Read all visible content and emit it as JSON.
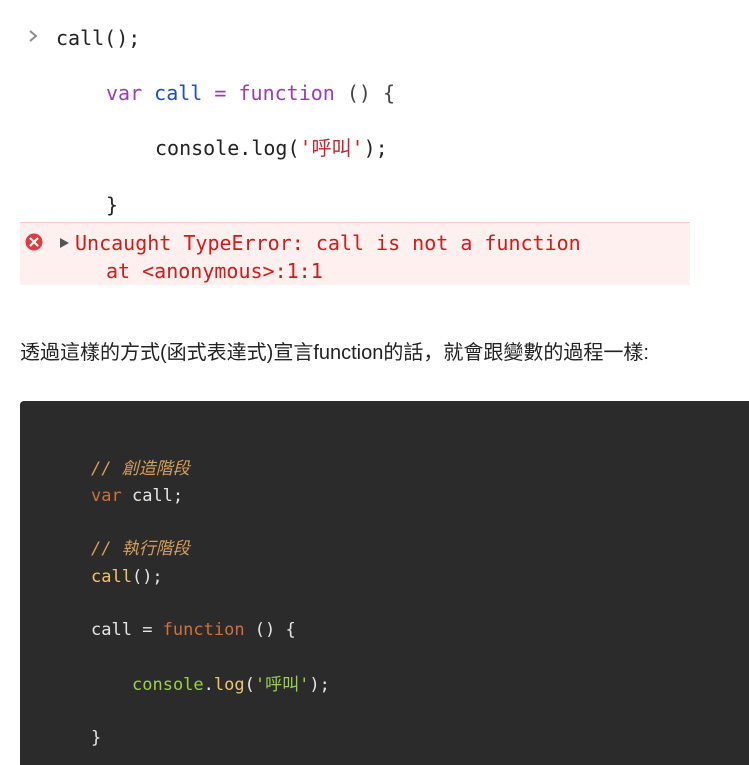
{
  "console": {
    "input": "call();",
    "code": {
      "line1": {
        "kw": "var",
        "name": "call",
        "op": "=",
        "fn": "function",
        "rest": "() {"
      },
      "line2": {
        "pre": "console.log(",
        "str": "'呼叫'",
        "post": ");"
      },
      "line3": "}"
    },
    "error": {
      "message": "Uncaught TypeError: call is not a function",
      "trace": "at <anonymous>:1:1"
    }
  },
  "paragraph": "透過這樣的方式(函式表達式)宣言function的話，就會跟變數的過程一樣:",
  "code_block": {
    "comment1": "// 創造階段",
    "line_var": {
      "kw": "var",
      "rest": " call;"
    },
    "comment2": "// 執行階段",
    "line_call": {
      "fn": "call",
      "rest": "();"
    },
    "line_assign": {
      "name": "call",
      "op": " = ",
      "kw": "function",
      "rest": " () {"
    },
    "line_log": {
      "obj": "console",
      "dot": ".",
      "meth": "log",
      "open": "(",
      "str": "'呼叫'",
      "close": ");"
    },
    "line_close": "}"
  },
  "colors": {
    "error_text": "#d11a1a",
    "error_bg": "#fff0f0",
    "code_bg": "#2b2b2b",
    "keyword_purple": "#9a3cb8",
    "identifier_blue": "#1f4ec2"
  }
}
